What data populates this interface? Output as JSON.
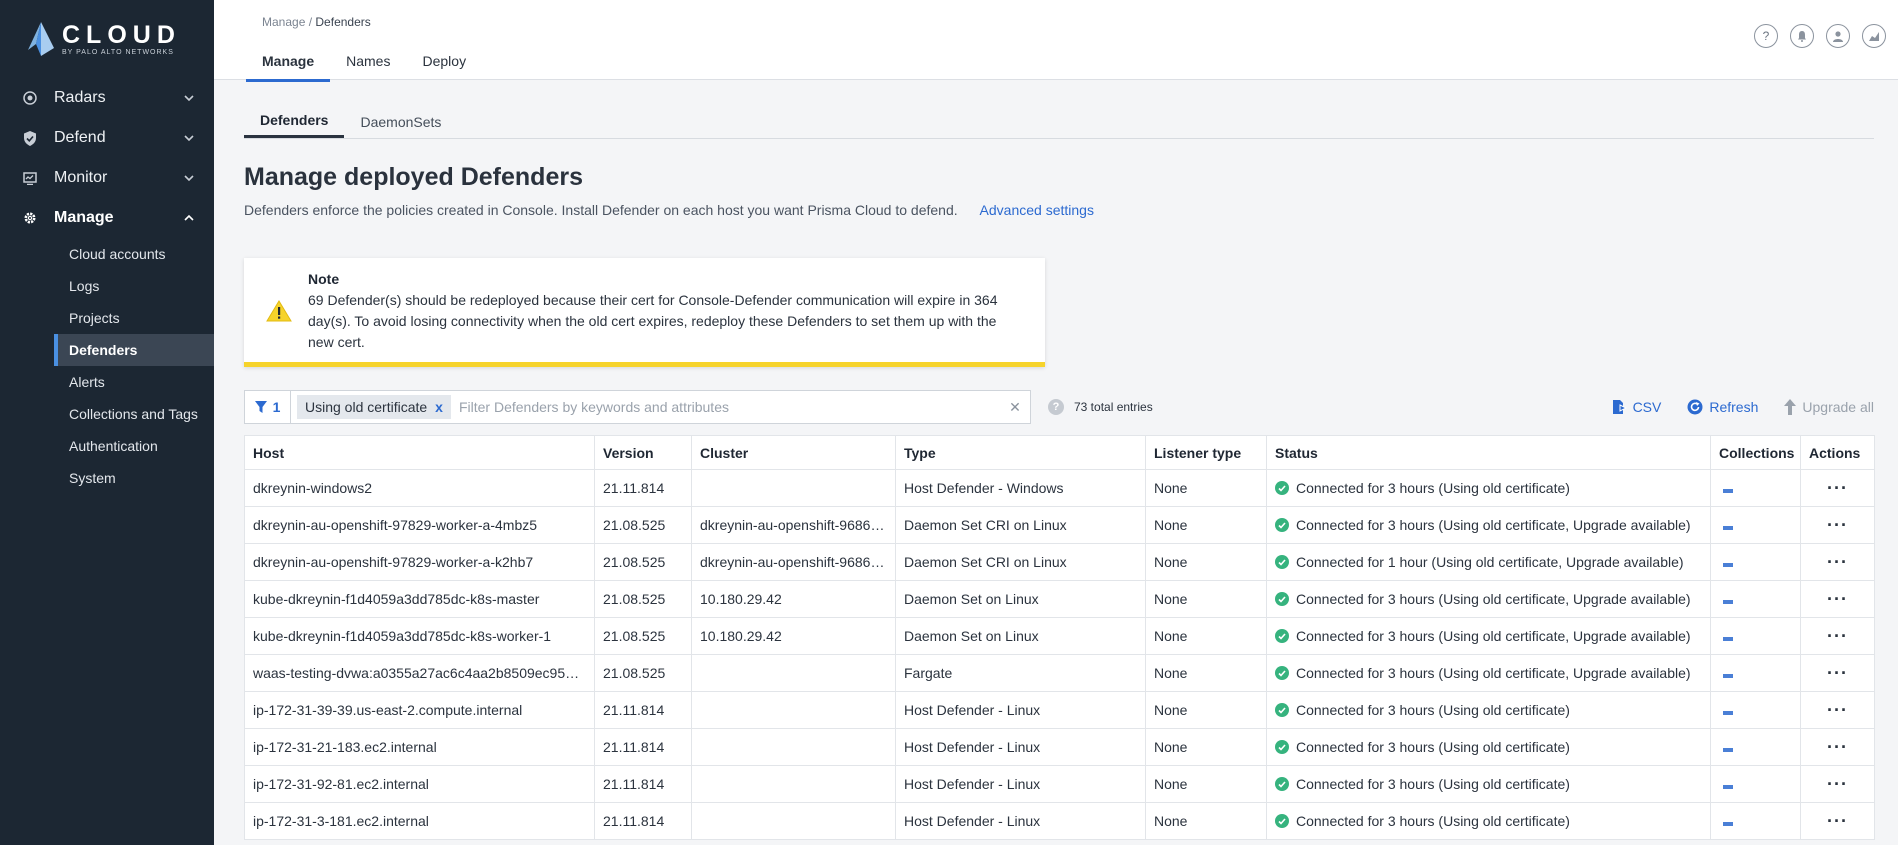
{
  "logo": {
    "word": "CLOUD",
    "sub": "BY PALO ALTO NETWORKS"
  },
  "sidebar": {
    "groups": [
      {
        "label": "Radars",
        "icon": "radar-icon",
        "expanded": false
      },
      {
        "label": "Defend",
        "icon": "shield-icon",
        "expanded": false
      },
      {
        "label": "Monitor",
        "icon": "monitor-icon",
        "expanded": false
      },
      {
        "label": "Manage",
        "icon": "gear-icon",
        "expanded": true
      }
    ],
    "subitems": [
      "Cloud accounts",
      "Logs",
      "Projects",
      "Defenders",
      "Alerts",
      "Collections and Tags",
      "Authentication",
      "System"
    ],
    "active_subitem": "Defenders"
  },
  "breadcrumb": {
    "parent": "Manage",
    "separator": " / ",
    "current": "Defenders"
  },
  "top_tabs": [
    "Manage",
    "Names",
    "Deploy"
  ],
  "sub_tabs": [
    "Defenders",
    "DaemonSets"
  ],
  "page": {
    "title": "Manage deployed Defenders",
    "description": "Defenders enforce the policies created in Console. Install Defender on each host you want Prisma Cloud to defend.",
    "advanced_link": "Advanced settings"
  },
  "note": {
    "title": "Note",
    "body": "69 Defender(s) should be redeployed because their cert for Console-Defender communication will expire in 364 day(s). To avoid losing connectivity when the old cert expires, redeploy these Defenders to set them up with the new cert."
  },
  "filter": {
    "count": "1",
    "chip": "Using old certificate",
    "chip_remove": "x",
    "placeholder": "Filter Defenders by keywords and attributes",
    "help": "?",
    "total": "73 total entries"
  },
  "actions": {
    "csv": "CSV",
    "refresh": "Refresh",
    "upgrade": "Upgrade all"
  },
  "table": {
    "headers": [
      "Host",
      "Version",
      "Cluster",
      "Type",
      "Listener type",
      "Status",
      "Collections",
      "Actions"
    ],
    "rows": [
      [
        "dkreynin-windows2",
        "21.11.814",
        "",
        "Host Defender - Windows",
        "None",
        "Connected for 3 hours (Using old certificate)"
      ],
      [
        "dkreynin-au-openshift-97829-worker-a-4mbz5",
        "21.08.525",
        "dkreynin-au-openshift-9686…",
        "Daemon Set CRI on Linux",
        "None",
        "Connected for 3 hours (Using old certificate, Upgrade available)"
      ],
      [
        "dkreynin-au-openshift-97829-worker-a-k2hb7",
        "21.08.525",
        "dkreynin-au-openshift-9686…",
        "Daemon Set CRI on Linux",
        "None",
        "Connected for 1 hour (Using old certificate, Upgrade available)"
      ],
      [
        "kube-dkreynin-f1d4059a3dd785dc-k8s-master",
        "21.08.525",
        "10.180.29.42",
        "Daemon Set on Linux",
        "None",
        "Connected for 3 hours (Using old certificate, Upgrade available)"
      ],
      [
        "kube-dkreynin-f1d4059a3dd785dc-k8s-worker-1",
        "21.08.525",
        "10.180.29.42",
        "Daemon Set on Linux",
        "None",
        "Connected for 3 hours (Using old certificate, Upgrade available)"
      ],
      [
        "waas-testing-dvwa:a0355a27ac6c4aa2b8509ec957…",
        "21.08.525",
        "",
        "Fargate",
        "None",
        "Connected for 3 hours (Using old certificate, Upgrade available)"
      ],
      [
        "ip-172-31-39-39.us-east-2.compute.internal",
        "21.11.814",
        "",
        "Host Defender - Linux",
        "None",
        "Connected for 3 hours (Using old certificate)"
      ],
      [
        "ip-172-31-21-183.ec2.internal",
        "21.11.814",
        "",
        "Host Defender - Linux",
        "None",
        "Connected for 3 hours (Using old certificate)"
      ],
      [
        "ip-172-31-92-81.ec2.internal",
        "21.11.814",
        "",
        "Host Defender - Linux",
        "None",
        "Connected for 3 hours (Using old certificate)"
      ],
      [
        "ip-172-31-3-181.ec2.internal",
        "21.11.814",
        "",
        "Host Defender - Linux",
        "None",
        "Connected for 3 hours (Using old certificate)"
      ]
    ],
    "row_action": "···"
  },
  "colors": {
    "sidebar_bg": "#1c2733",
    "accent": "#2c6ad0",
    "ok": "#36b37e",
    "warning": "#f6d32b"
  }
}
